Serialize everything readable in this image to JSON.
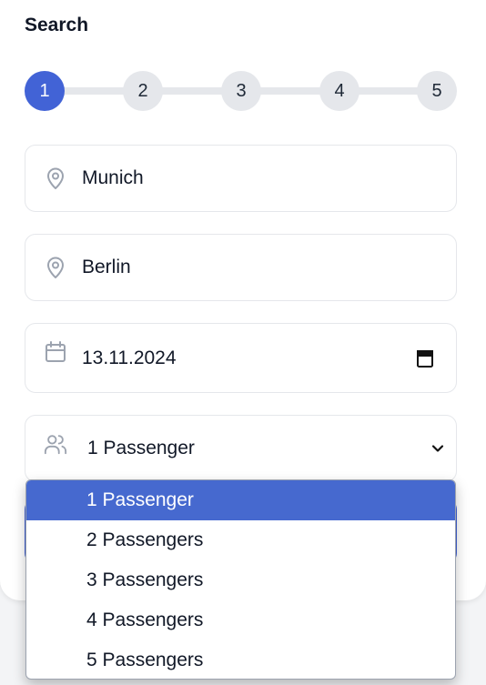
{
  "header": {
    "title": "Search"
  },
  "steps": [
    {
      "label": "1",
      "active": true
    },
    {
      "label": "2",
      "active": false
    },
    {
      "label": "3",
      "active": false
    },
    {
      "label": "4",
      "active": false
    },
    {
      "label": "5",
      "active": false
    }
  ],
  "form": {
    "origin": {
      "value": "Munich",
      "icon": "map-pin-icon"
    },
    "destination": {
      "value": "Berlin",
      "icon": "map-pin-icon"
    },
    "date": {
      "value": "13.11.2024",
      "icon": "calendar-icon",
      "picker_icon": "calendar-picker-icon"
    },
    "passengers": {
      "value": "1 Passenger",
      "icon": "users-icon",
      "chevron_icon": "chevron-down-icon"
    }
  },
  "dropdown": {
    "options": [
      "1 Passenger",
      "2 Passengers",
      "3 Passengers",
      "4 Passengers",
      "5 Passengers"
    ],
    "selected_index": 0
  },
  "colors": {
    "accent": "#4263d6",
    "step_inactive": "#e5e7eb",
    "option_selected": "#4669cf",
    "icon_muted": "#9ca3af"
  }
}
